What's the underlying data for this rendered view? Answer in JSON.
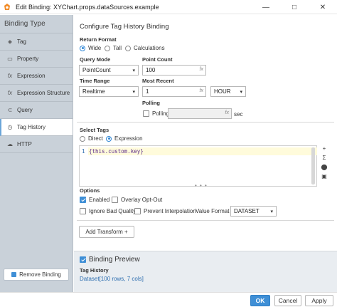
{
  "window": {
    "title": "Edit Binding: XYChart.props.dataSources.example",
    "controls": [
      "—",
      "□",
      "✕"
    ]
  },
  "sidebar": {
    "header": "Binding Type",
    "items": [
      {
        "label": "Tag",
        "icon": "tag-icon",
        "glyph": "◈"
      },
      {
        "label": "Property",
        "icon": "property-icon",
        "glyph": "▭"
      },
      {
        "label": "Expression",
        "icon": "function-icon",
        "glyph": "fx"
      },
      {
        "label": "Expression Structure",
        "icon": "function-icon",
        "glyph": "fx"
      },
      {
        "label": "Query",
        "icon": "query-icon",
        "glyph": "⊂"
      },
      {
        "label": "Tag History",
        "icon": "clock-icon",
        "glyph": "◷"
      },
      {
        "label": "HTTP",
        "icon": "cloud-icon",
        "glyph": "☁"
      }
    ],
    "active_index": 5,
    "remove_label": "Remove Binding"
  },
  "config": {
    "title": "Configure Tag History Binding",
    "return_format_label": "Return Format",
    "return_format_options": [
      "Wide",
      "Tall",
      "Calculations"
    ],
    "return_format_selected": "Wide",
    "query_mode_label": "Query Mode",
    "query_mode_value": "PointCount",
    "point_count_label": "Point Count",
    "point_count_value": "100",
    "time_range_label": "Time Range",
    "time_range_value": "Realtime",
    "most_recent_label": "Most Recent",
    "most_recent_value": "1",
    "most_recent_unit": "HOUR",
    "polling_label": "Polling",
    "polling_checkbox_label": "Polling",
    "polling_unit": "sec",
    "fx_glyph": "fx",
    "chevron": "▾"
  },
  "select_tags": {
    "label": "Select Tags",
    "options": [
      "Direct",
      "Expression"
    ],
    "selected": "Expression",
    "line_number": "1",
    "code": "{this.custom.key}",
    "tools": [
      "+",
      "Σ",
      "⬤",
      "▣"
    ]
  },
  "options": {
    "label": "Options",
    "enabled_label": "Enabled",
    "enabled_checked": true,
    "overlay_label": "Overlay Opt-Out",
    "overlay_checked": false,
    "ignore_bad_label": "Ignore Bad Quality",
    "ignore_bad_checked": false,
    "prevent_interp_label": "Prevent Interpolation",
    "prevent_interp_checked": false,
    "value_format_label": "Value Format",
    "value_format_value": "DATASET"
  },
  "transform": {
    "add_label": "Add Transform +"
  },
  "preview": {
    "label": "Binding Preview",
    "checked": true,
    "source_label": "Tag History",
    "result": "Dataset[100 rows, 7 cols]"
  },
  "footer": {
    "ok": "OK",
    "cancel": "Cancel",
    "apply": "Apply"
  },
  "colors": {
    "accent": "#3f8fd6",
    "sidebar_bg": "#c9d1d9",
    "link": "#2f6fb0"
  }
}
